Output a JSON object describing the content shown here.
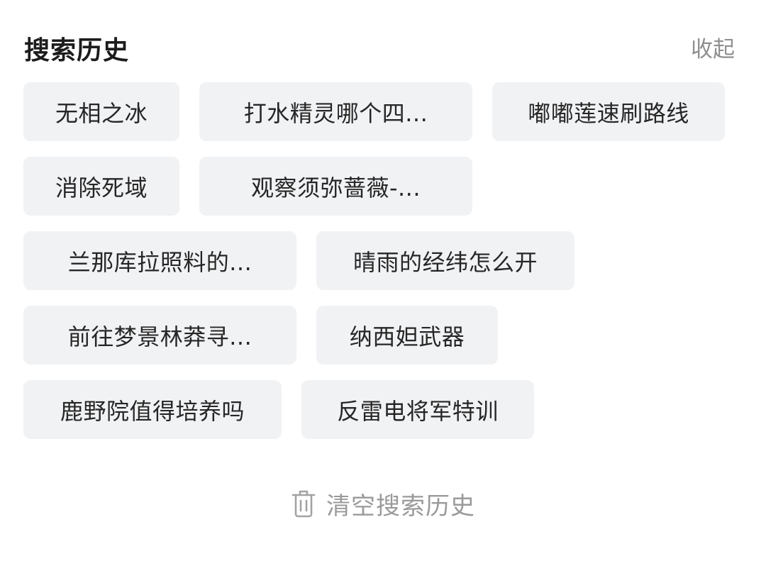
{
  "header": {
    "title": "搜索历史",
    "collapse_label": "收起"
  },
  "history": [
    {
      "label": "无相之冰"
    },
    {
      "label": "打水精灵哪个四..."
    },
    {
      "label": "嘟嘟莲速刷路线"
    },
    {
      "label": "消除死域"
    },
    {
      "label": "观察须弥蔷薇-..."
    },
    {
      "label": "兰那库拉照料的..."
    },
    {
      "label": "晴雨的经纬怎么开"
    },
    {
      "label": "前往梦景林莽寻..."
    },
    {
      "label": "纳西妲武器"
    },
    {
      "label": "鹿野院值得培养吗"
    },
    {
      "label": "反雷电将军特训"
    }
  ],
  "footer": {
    "clear_label": "清空搜索历史",
    "clear_icon": "trash-icon"
  },
  "colors": {
    "tag_background": "#f1f2f4",
    "muted_text": "#9a9a9a",
    "primary_text": "#262626"
  }
}
